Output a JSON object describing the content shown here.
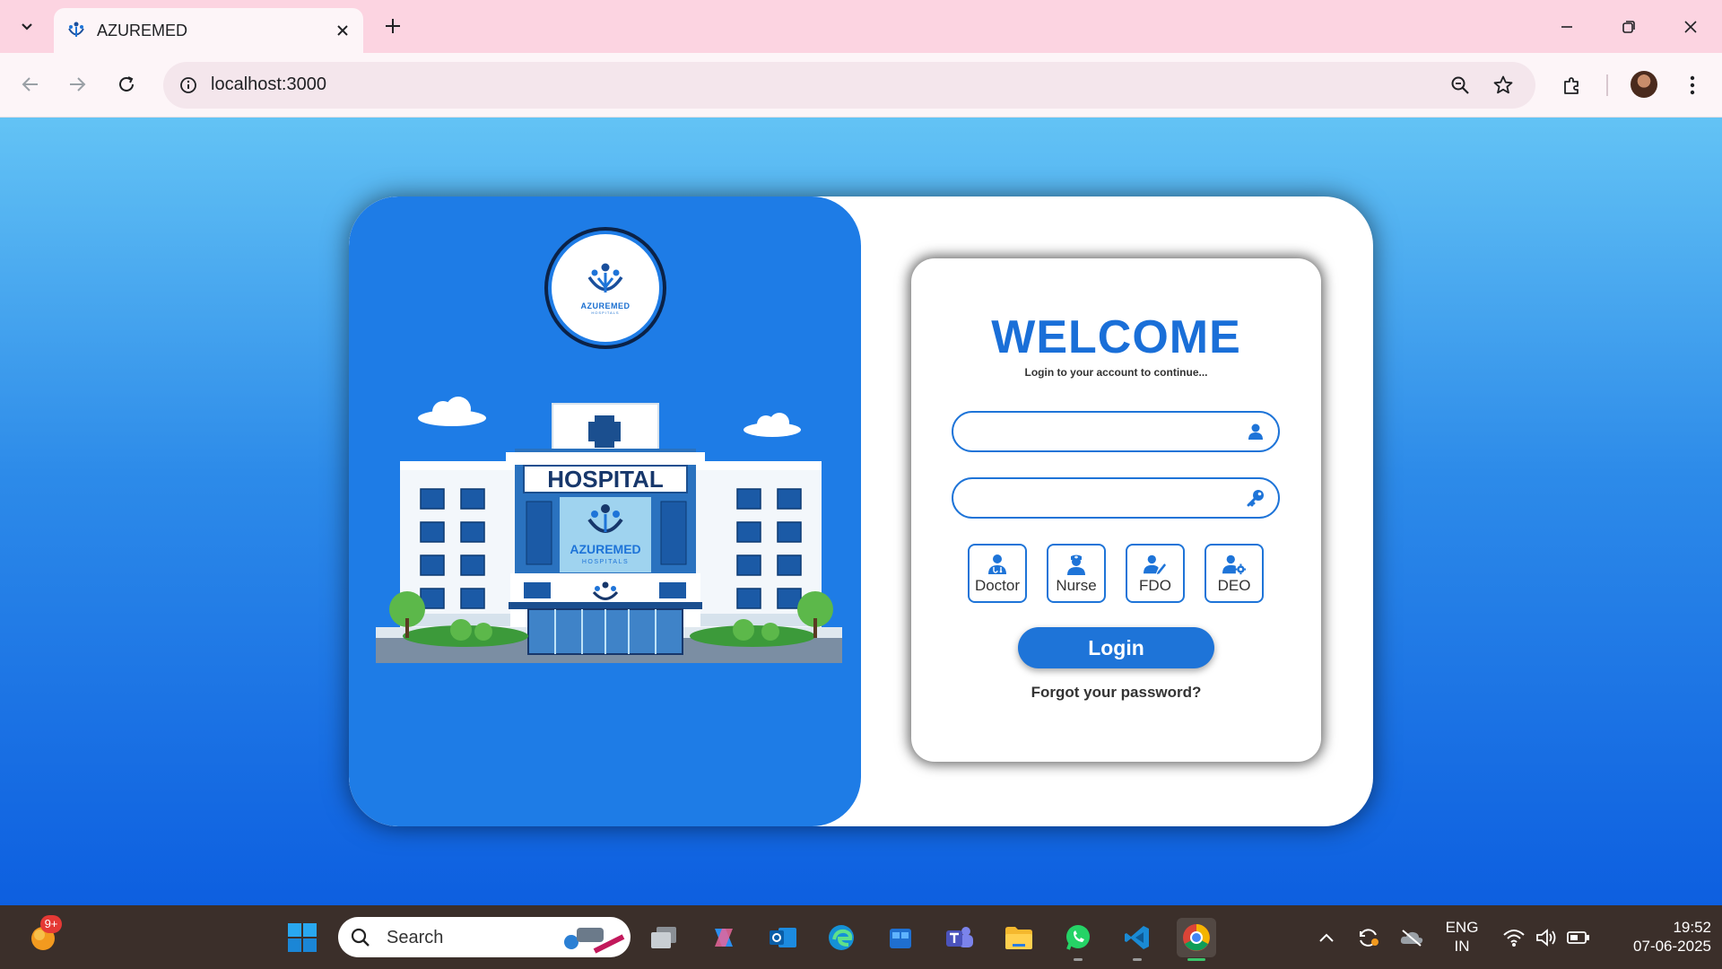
{
  "browser": {
    "tab_title": "AZUREMED",
    "url": "localhost:3000"
  },
  "page": {
    "logo_text": "AZUREMED",
    "logo_sub": "HOSPITALS",
    "art": {
      "sign": "HOSPITAL",
      "brand": "AZUREMED",
      "brand_sub": "HOSPITALS"
    },
    "welcome": "WELCOME",
    "subtitle": "Login to your account to continue...",
    "username_placeholder": "",
    "password_placeholder": "",
    "roles": [
      {
        "label": "Doctor",
        "icon": "doctor-icon"
      },
      {
        "label": "Nurse",
        "icon": "nurse-icon"
      },
      {
        "label": "FDO",
        "icon": "user-pen-icon"
      },
      {
        "label": "DEO",
        "icon": "user-gear-icon"
      }
    ],
    "login_label": "Login",
    "forgot_label": "Forgot your password?",
    "colors": {
      "primary": "#1e74d8",
      "left_panel": "#1e7ce6",
      "welcome_text": "#1a6fd8"
    }
  },
  "taskbar": {
    "notification_badge": "9+",
    "search_label": "Search",
    "lang_top": "ENG",
    "lang_bottom": "IN",
    "time": "19:52",
    "date": "07-06-2025"
  }
}
